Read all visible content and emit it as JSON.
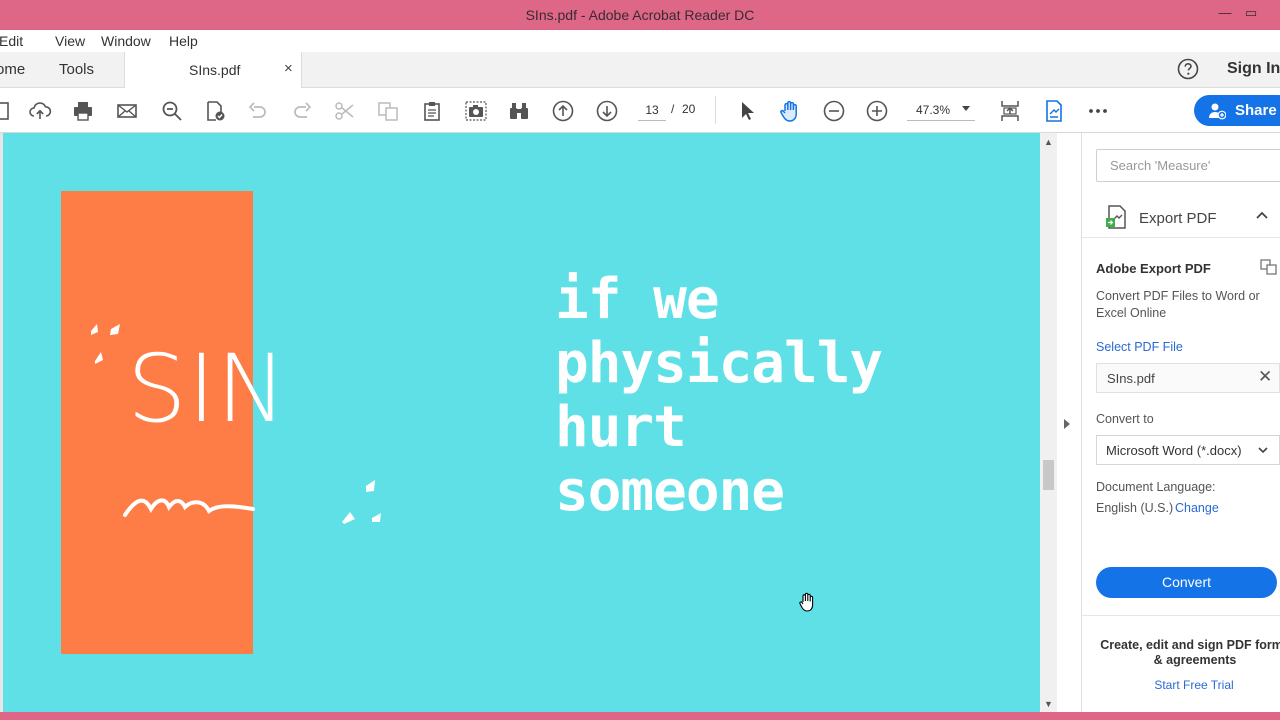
{
  "window": {
    "title": "SIns.pdf - Adobe Acrobat Reader DC",
    "minimize_glyph": "—",
    "maximize_glyph": "▭"
  },
  "menu": [
    "Edit",
    "View",
    "Window",
    "Help"
  ],
  "tabs": {
    "home": "ome",
    "tools": "Tools",
    "document": "SIns.pdf",
    "close": "×"
  },
  "header": {
    "sign_in": "Sign In"
  },
  "toolbar": {
    "current_page": "13",
    "page_separator": "/",
    "total_pages": "20",
    "zoom": "47.3%",
    "share": "Share"
  },
  "document": {
    "big_word": "SIN",
    "phrase_lines": [
      "if we",
      "physically",
      "hurt",
      "someone"
    ],
    "colors": {
      "background": "#5ee0e6",
      "panel": "#fe7c46",
      "text": "#ffffff"
    }
  },
  "panel": {
    "search_placeholder": "Search 'Measure'",
    "export_title": "Export PDF",
    "heading": "Adobe Export PDF",
    "description": "Convert PDF Files to Word or Excel Online",
    "select_label": "Select PDF File",
    "file_name": "SIns.pdf",
    "file_clear": "✕",
    "convert_to_label": "Convert to",
    "convert_to_value": "Microsoft Word (*.docx)",
    "language_label": "Document Language:",
    "language_value": "English (U.S.)",
    "change_link": "Change",
    "convert_button": "Convert",
    "promo": "Create, edit and sign PDF forms & agreements",
    "trial_link": "Start Free Trial"
  },
  "icons": [
    "save-icon",
    "upload-icon",
    "print-icon",
    "mail-icon",
    "search-icon",
    "document-check-icon",
    "undo-icon",
    "redo-icon",
    "scissors-icon",
    "copy-icon",
    "clipboard-icon",
    "snapshot-icon",
    "binoculars-icon",
    "page-up-icon",
    "page-down-icon",
    "select-arrow-icon",
    "hand-icon",
    "zoom-out-icon",
    "zoom-in-icon",
    "fit-page-icon",
    "export-icon",
    "more-icon",
    "help-icon",
    "share-user-icon"
  ],
  "accent_color": "#1473e6",
  "titlebar_color": "#de6788"
}
